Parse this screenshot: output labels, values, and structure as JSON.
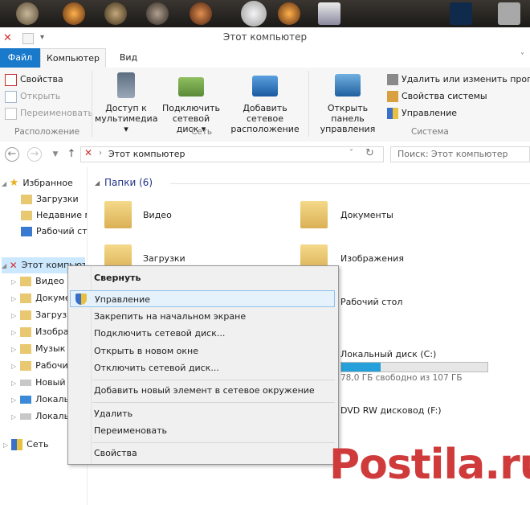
{
  "window": {
    "title": "Этот компьютер"
  },
  "ribbon_tabs": [
    "Файл",
    "Компьютер",
    "Вид"
  ],
  "ribbon": {
    "location_group": {
      "label": "Расположение",
      "items": [
        "Свойства",
        "Открыть",
        "Переименовать"
      ]
    },
    "network_group": {
      "label": "Сеть",
      "items": [
        {
          "line1": "Доступ к",
          "line2": "мультимедиа ▾"
        },
        {
          "line1": "Подключить",
          "line2": "сетевой диск ▾"
        },
        {
          "line1": "Добавить сетевое",
          "line2": "расположение"
        }
      ]
    },
    "system_group": {
      "label": "Система",
      "control_panel": {
        "line1": "Открыть панель",
        "line2": "управления"
      },
      "items": [
        "Удалить или изменить програм",
        "Свойства системы",
        "Управление"
      ]
    }
  },
  "address": {
    "path": "Этот компьютер",
    "search_placeholder": "Поиск: Этот компьютер"
  },
  "nav": {
    "favorites": {
      "label": "Избранное",
      "items": [
        "Загрузки",
        "Недавние м",
        "Рабочий ст"
      ]
    },
    "this_pc": {
      "label": "Этот компьютер",
      "items": [
        "Видео",
        "Докуме",
        "Загруз",
        "Изобра",
        "Музык",
        "Рабочи",
        "Новый",
        "Локаль",
        "Локаль"
      ]
    },
    "network": {
      "label": "Сеть"
    }
  },
  "content": {
    "folders_header": "Папки (6)",
    "folders": [
      "Видео",
      "Документы",
      "Загрузки",
      "Изображения",
      "Рабочий стол"
    ],
    "drives": [
      {
        "name": "Локальный диск (C:)",
        "free": "78,0 ГБ свободно из 107 ГБ",
        "used_fraction": 0.27
      },
      {
        "name": "DVD RW дисковод (F:)"
      }
    ]
  },
  "context_menu": {
    "items": [
      "Свернуть",
      "Управление",
      "Закрепить на начальном экране",
      "Подключить сетевой диск...",
      "Открыть в новом окне",
      "Отключить сетевой диск...",
      "Добавить новый элемент в сетевое окружение",
      "Удалить",
      "Переименовать",
      "Свойства"
    ]
  },
  "watermark": "Postila.ru",
  "colors": {
    "accent": "#1979ca",
    "drive_bar": "#26a0da",
    "watermark": "#cf3b3b"
  }
}
